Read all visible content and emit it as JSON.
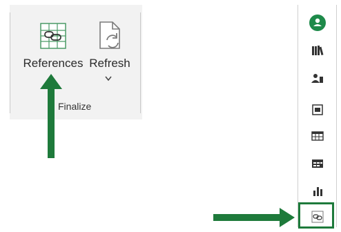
{
  "ribbon": {
    "references_label": "References",
    "refresh_label": "Refresh",
    "group_label": "Finalize"
  },
  "panel": {
    "items": [
      "add-icon",
      "books-icon",
      "people-icon",
      "film-icon",
      "table-icon",
      "table-layout-icon",
      "bar-chart-icon",
      "references-icon"
    ]
  },
  "colors": {
    "accent_green": "#1e7a3b",
    "icon_green": "#3a9a5b",
    "ribbon_bg": "#f2f2f2"
  }
}
